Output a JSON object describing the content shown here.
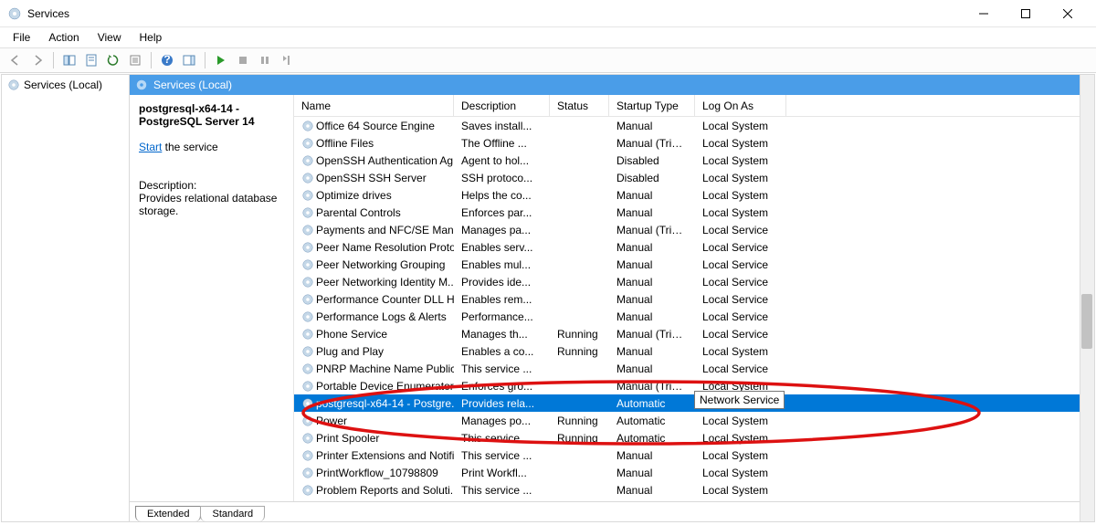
{
  "window": {
    "title": "Services"
  },
  "menus": [
    "File",
    "Action",
    "View",
    "Help"
  ],
  "tree_root": "Services (Local)",
  "pane_header": "Services (Local)",
  "selected_service": {
    "name": "postgresql-x64-14 - PostgreSQL Server 14",
    "start_link": "Start",
    "start_suffix": " the service",
    "desc_label": "Description:",
    "desc_text": "Provides relational database storage."
  },
  "columns": [
    "Name",
    "Description",
    "Status",
    "Startup Type",
    "Log On As"
  ],
  "logon_tooltip": "Network Service",
  "rows": [
    {
      "name": "Office 64 Source Engine",
      "desc": "Saves install...",
      "status": "",
      "startup": "Manual",
      "logon": "Local System"
    },
    {
      "name": "Offline Files",
      "desc": "The Offline ...",
      "status": "",
      "startup": "Manual (Trigg...",
      "logon": "Local System"
    },
    {
      "name": "OpenSSH Authentication Ag...",
      "desc": "Agent to hol...",
      "status": "",
      "startup": "Disabled",
      "logon": "Local System"
    },
    {
      "name": "OpenSSH SSH Server",
      "desc": "SSH protoco...",
      "status": "",
      "startup": "Disabled",
      "logon": "Local System"
    },
    {
      "name": "Optimize drives",
      "desc": "Helps the co...",
      "status": "",
      "startup": "Manual",
      "logon": "Local System"
    },
    {
      "name": "Parental Controls",
      "desc": "Enforces par...",
      "status": "",
      "startup": "Manual",
      "logon": "Local System"
    },
    {
      "name": "Payments and NFC/SE Mana...",
      "desc": "Manages pa...",
      "status": "",
      "startup": "Manual (Trigg...",
      "logon": "Local Service"
    },
    {
      "name": "Peer Name Resolution Proto...",
      "desc": "Enables serv...",
      "status": "",
      "startup": "Manual",
      "logon": "Local Service"
    },
    {
      "name": "Peer Networking Grouping",
      "desc": "Enables mul...",
      "status": "",
      "startup": "Manual",
      "logon": "Local Service"
    },
    {
      "name": "Peer Networking Identity M...",
      "desc": "Provides ide...",
      "status": "",
      "startup": "Manual",
      "logon": "Local Service"
    },
    {
      "name": "Performance Counter DLL H...",
      "desc": "Enables rem...",
      "status": "",
      "startup": "Manual",
      "logon": "Local Service"
    },
    {
      "name": "Performance Logs & Alerts",
      "desc": "Performance...",
      "status": "",
      "startup": "Manual",
      "logon": "Local Service"
    },
    {
      "name": "Phone Service",
      "desc": "Manages th...",
      "status": "Running",
      "startup": "Manual (Trigg...",
      "logon": "Local Service"
    },
    {
      "name": "Plug and Play",
      "desc": "Enables a co...",
      "status": "Running",
      "startup": "Manual",
      "logon": "Local System"
    },
    {
      "name": "PNRP Machine Name Public...",
      "desc": "This service ...",
      "status": "",
      "startup": "Manual",
      "logon": "Local Service"
    },
    {
      "name": "Portable Device Enumerator ...",
      "desc": "Enforces gro...",
      "status": "",
      "startup": "Manual (Trigg...",
      "logon": "Local System"
    },
    {
      "name": "postgresql-x64-14 - Postgre...",
      "desc": "Provides rela...",
      "status": "",
      "startup": "Automatic",
      "logon": "Network Se...",
      "selected": true
    },
    {
      "name": "Power",
      "desc": "Manages po...",
      "status": "Running",
      "startup": "Automatic",
      "logon": "Local System"
    },
    {
      "name": "Print Spooler",
      "desc": "This service ...",
      "status": "Running",
      "startup": "Automatic",
      "logon": "Local System"
    },
    {
      "name": "Printer Extensions and Notifi...",
      "desc": "This service ...",
      "status": "",
      "startup": "Manual",
      "logon": "Local System"
    },
    {
      "name": "PrintWorkflow_10798809",
      "desc": "Print Workfl...",
      "status": "",
      "startup": "Manual",
      "logon": "Local System"
    },
    {
      "name": "Problem Reports and Soluti...",
      "desc": "This service ...",
      "status": "",
      "startup": "Manual",
      "logon": "Local System"
    }
  ],
  "tabs": [
    "Extended",
    "Standard"
  ]
}
